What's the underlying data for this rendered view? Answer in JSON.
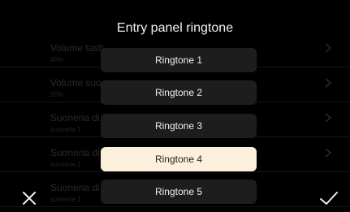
{
  "dialog": {
    "title": "Entry panel ringtone"
  },
  "background_items": [
    {
      "title": "Volume tasti",
      "subtitle": "40%"
    },
    {
      "title": "Volume suoneria",
      "subtitle": "20%"
    },
    {
      "title": "Suoneria di chiamata",
      "subtitle": "suoneria 1"
    },
    {
      "title": "Suoneria di piano",
      "subtitle": "suoneria 1"
    },
    {
      "title": "Suoneria di",
      "subtitle": "suoneria 1"
    }
  ],
  "options": [
    {
      "label": "Ringtone 1"
    },
    {
      "label": "Ringtone 2"
    },
    {
      "label": "Ringtone 3"
    },
    {
      "label": "Ringtone 4"
    },
    {
      "label": "Ringtone 5"
    }
  ],
  "selected_option": "Ringtone 4",
  "icons": {
    "cancel": "close-icon",
    "confirm": "check-icon",
    "row_arrow": "chevron-right-icon"
  },
  "colors": {
    "background": "#000000",
    "option": "#1d1d1d",
    "selected": "#fcefdc",
    "text": "#f0f0f0"
  }
}
